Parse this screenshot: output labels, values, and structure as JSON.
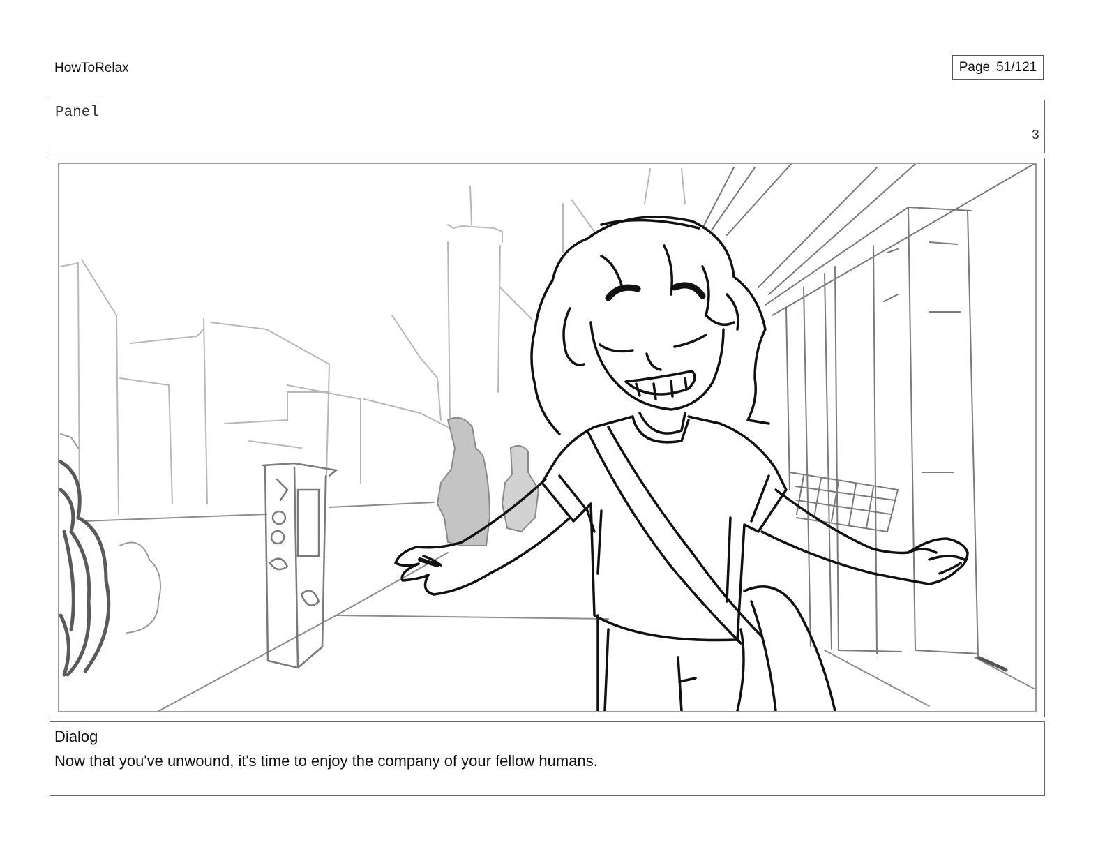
{
  "header": {
    "project_title": "HowToRelax",
    "page_label": "Page",
    "page_number": "51/121"
  },
  "panel": {
    "label": "Panel",
    "number": "3"
  },
  "dialog": {
    "label": "Dialog",
    "text": "Now that you've unwound, it's time to enjoy the company of your fellow humans."
  }
}
